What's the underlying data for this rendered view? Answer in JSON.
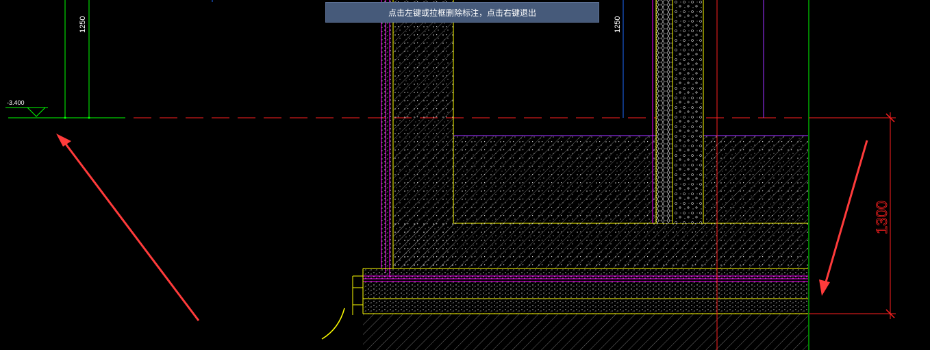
{
  "prompt": {
    "message": "点击左键或拉框删除标注，点击右键退出"
  },
  "drawing": {
    "elevation_label": "-3.400",
    "dimension_left": "1250",
    "dimension_right": "1250",
    "dimension_height": "1300"
  },
  "colors": {
    "background": "#000000",
    "dimension_line": "#00ff00",
    "axis_line": "#ff0000",
    "wall_outline": "#ffff00",
    "waterproof_layer": "#ff00ff",
    "room_outline": "#8a2be2",
    "blue_line": "#1e6bff",
    "annotation_arrow": "#ff3b3b",
    "hint_bar_bg": "#465a7a",
    "hint_text": "#ffffff"
  }
}
